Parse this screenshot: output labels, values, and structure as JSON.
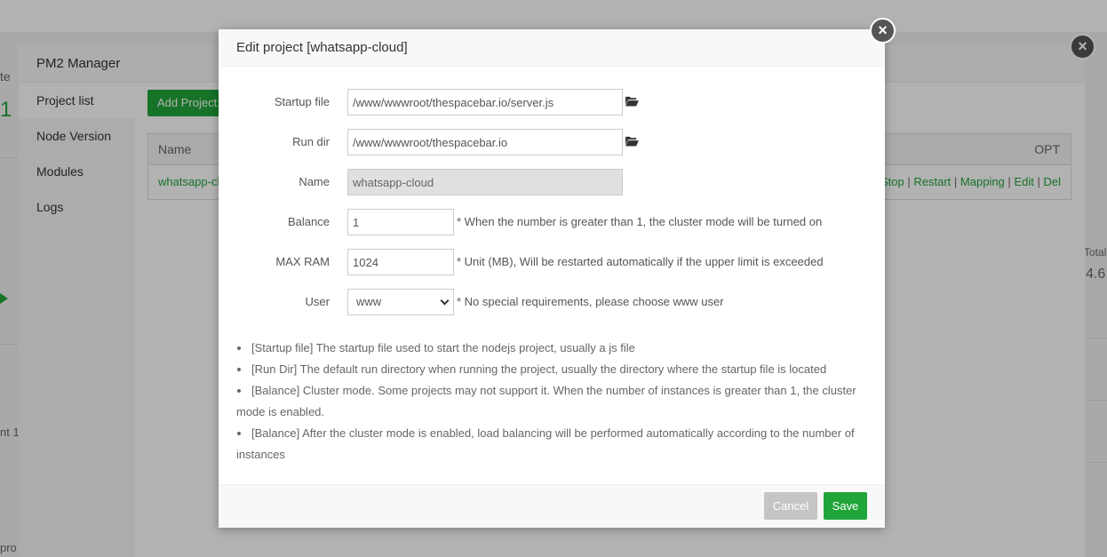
{
  "background": {
    "fragments": [
      "te",
      "1",
      "nt 1",
      "pro",
      "Total",
      "4.6"
    ]
  },
  "pm2": {
    "title": "PM2 Manager",
    "sidebar": [
      "Project list",
      "Node Version",
      "Modules",
      "Logs"
    ],
    "add_button": "Add Project",
    "table": {
      "col_name": "Name",
      "col_opt": "OPT",
      "row_name": "whatsapp-cloud",
      "ops": [
        "Stop",
        "Restart",
        "Mapping",
        "Edit",
        "Del"
      ],
      "separator": "|"
    }
  },
  "dialog": {
    "title": "Edit project [whatsapp-cloud]",
    "fields": {
      "startup_file": {
        "label": "Startup file",
        "value": "/www/wwwroot/thespacebar.io/server.js"
      },
      "run_dir": {
        "label": "Run dir",
        "value": "/www/wwwroot/thespacebar.io"
      },
      "name": {
        "label": "Name",
        "value": "whatsapp-cloud"
      },
      "balance": {
        "label": "Balance",
        "value": "1",
        "hint": "* When the number is greater than 1, the cluster mode will be turned on"
      },
      "max_ram": {
        "label": "MAX RAM",
        "value": "1024",
        "hint": "* Unit (MB), Will be restarted automatically if the upper limit is exceeded"
      },
      "user": {
        "label": "User",
        "value": "www",
        "hint": "* No special requirements, please choose www user"
      }
    },
    "notes": [
      "[Startup file] The startup file used to start the nodejs project, usually a js file",
      "[Run Dir] The default run directory when running the project, usually the directory where the startup file is located",
      "[Balance] Cluster mode. Some projects may not support it. When the number of instances is greater than 1, the cluster mode is enabled.",
      "[Balance] After the cluster mode is enabled, load balancing will be performed automatically according to the number of instances"
    ],
    "cancel_label": "Cancel",
    "save_label": "Save"
  },
  "icons": {
    "close": "close-icon",
    "folder": "folder-open-icon"
  },
  "colors": {
    "accent": "#20a53a",
    "cancel": "#c5c5c5"
  }
}
